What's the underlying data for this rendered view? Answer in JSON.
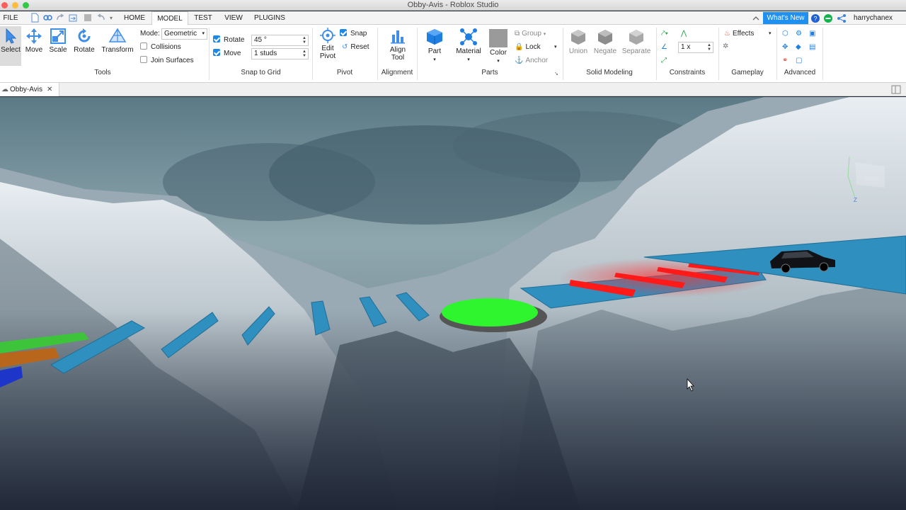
{
  "window": {
    "title": "Obby-Avis - Roblox Studio"
  },
  "menu": {
    "file": "FILE",
    "tabs": [
      "HOME",
      "MODEL",
      "TEST",
      "VIEW",
      "PLUGINS"
    ],
    "active_tab": "MODEL",
    "whats_new": "What's New",
    "username": "harrychanex"
  },
  "ribbon": {
    "tools": {
      "label": "Tools",
      "select": "Select",
      "move": "Move",
      "scale": "Scale",
      "rotate": "Rotate",
      "transform": "Transform",
      "mode_label": "Mode:",
      "mode_value": "Geometric",
      "collisions": "Collisions",
      "join_surfaces": "Join Surfaces"
    },
    "snap": {
      "label": "Snap to Grid",
      "rotate_label": "Rotate",
      "rotate_value": "45 °",
      "move_label": "Move",
      "move_value": "1 studs"
    },
    "pivot": {
      "label": "Pivot",
      "edit_line1": "Edit",
      "edit_line2": "Pivot",
      "snap": "Snap",
      "reset": "Reset"
    },
    "alignment": {
      "label": "Alignment",
      "align_line1": "Align",
      "align_line2": "Tool"
    },
    "parts": {
      "label": "Parts",
      "part": "Part",
      "material": "Material",
      "color": "Color",
      "group": "Group",
      "lock": "Lock",
      "anchor": "Anchor"
    },
    "solid": {
      "label": "Solid Modeling",
      "union": "Union",
      "negate": "Negate",
      "separate": "Separate"
    },
    "constraints": {
      "label": "Constraints",
      "scale_value": "1 x"
    },
    "gameplay": {
      "label": "Gameplay",
      "effects": "Effects"
    },
    "advanced": {
      "label": "Advanced"
    }
  },
  "document": {
    "tab_name": "Obby-Avis"
  },
  "viewport": {
    "view_cube_label": "Back",
    "axis_label": "Z"
  },
  "colors": {
    "accent": "#1e88e5",
    "whats_new_bg": "#1f8ff0",
    "platform_blue": "#2f8fbf",
    "checkpoint_green": "#2ef52e",
    "kill_red": "#ff1a1a"
  }
}
